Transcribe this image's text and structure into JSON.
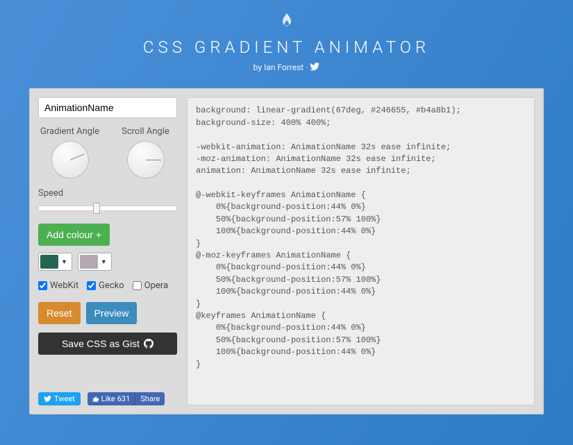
{
  "header": {
    "title": "CSS GRADIENT ANIMATOR",
    "byline_prefix": "by ",
    "byline_author": "Ian Forrest"
  },
  "controls": {
    "animation_name": "AnimationName",
    "gradient_angle_label": "Gradient Angle",
    "scroll_angle_label": "Scroll Angle",
    "gradient_angle_deg": 67,
    "scroll_angle_deg": 90,
    "speed_label": "Speed",
    "speed_value": 32,
    "speed_slider_pct": 42,
    "add_colour_label": "Add colour +",
    "colours": [
      "#246655",
      "#b4a8b1"
    ],
    "prefixes": [
      {
        "label": "WebKit",
        "checked": true
      },
      {
        "label": "Gecko",
        "checked": true
      },
      {
        "label": "Opera",
        "checked": false
      }
    ],
    "reset_label": "Reset",
    "preview_label": "Preview",
    "gist_label": "Save CSS as Gist"
  },
  "social": {
    "tweet_label": "Tweet",
    "fb_like_label": "Like",
    "fb_like_count": "631",
    "fb_share_label": "Share"
  },
  "code": "background: linear-gradient(67deg, #246655, #b4a8b1);\nbackground-size: 400% 400%;\n\n-webkit-animation: AnimationName 32s ease infinite;\n-moz-animation: AnimationName 32s ease infinite;\nanimation: AnimationName 32s ease infinite;\n\n@-webkit-keyframes AnimationName {\n    0%{background-position:44% 0%}\n    50%{background-position:57% 100%}\n    100%{background-position:44% 0%}\n}\n@-moz-keyframes AnimationName {\n    0%{background-position:44% 0%}\n    50%{background-position:57% 100%}\n    100%{background-position:44% 0%}\n}\n@keyframes AnimationName {\n    0%{background-position:44% 0%}\n    50%{background-position:57% 100%}\n    100%{background-position:44% 0%}\n}"
}
